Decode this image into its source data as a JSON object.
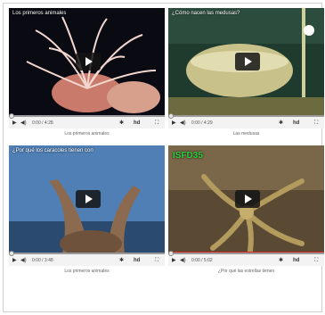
{
  "videos": [
    {
      "title": "Los primeros animales",
      "time": "0:00 / 4:28",
      "caption": "Los primeros animales",
      "hd": "hd",
      "overlay_badge": ""
    },
    {
      "title": "¿Cómo nacen las medusas?",
      "time": "0:00 / 4:29",
      "caption": "Las medusas",
      "hd": "hd",
      "overlay_badge": ""
    },
    {
      "title": "¿Por qué los caracoles tienen con",
      "time": "0:00 / 3:48",
      "caption": "Los primeros animales",
      "hd": "hd",
      "overlay_badge": ""
    },
    {
      "title": "",
      "time": "0:00 / 5:02",
      "caption": "¿Por qué las estrellas tienen",
      "hd": "hd",
      "overlay_badge": "ISFD35"
    }
  ],
  "controls": {
    "play_icon": "▶",
    "volume_icon": "◀)",
    "settings_icon": "✱",
    "fullscreen_icon": "⛶"
  },
  "colors": {
    "progress": "#9a9a9a",
    "badge_green": "#2ecc40",
    "progress_red": "#d62a2a"
  }
}
